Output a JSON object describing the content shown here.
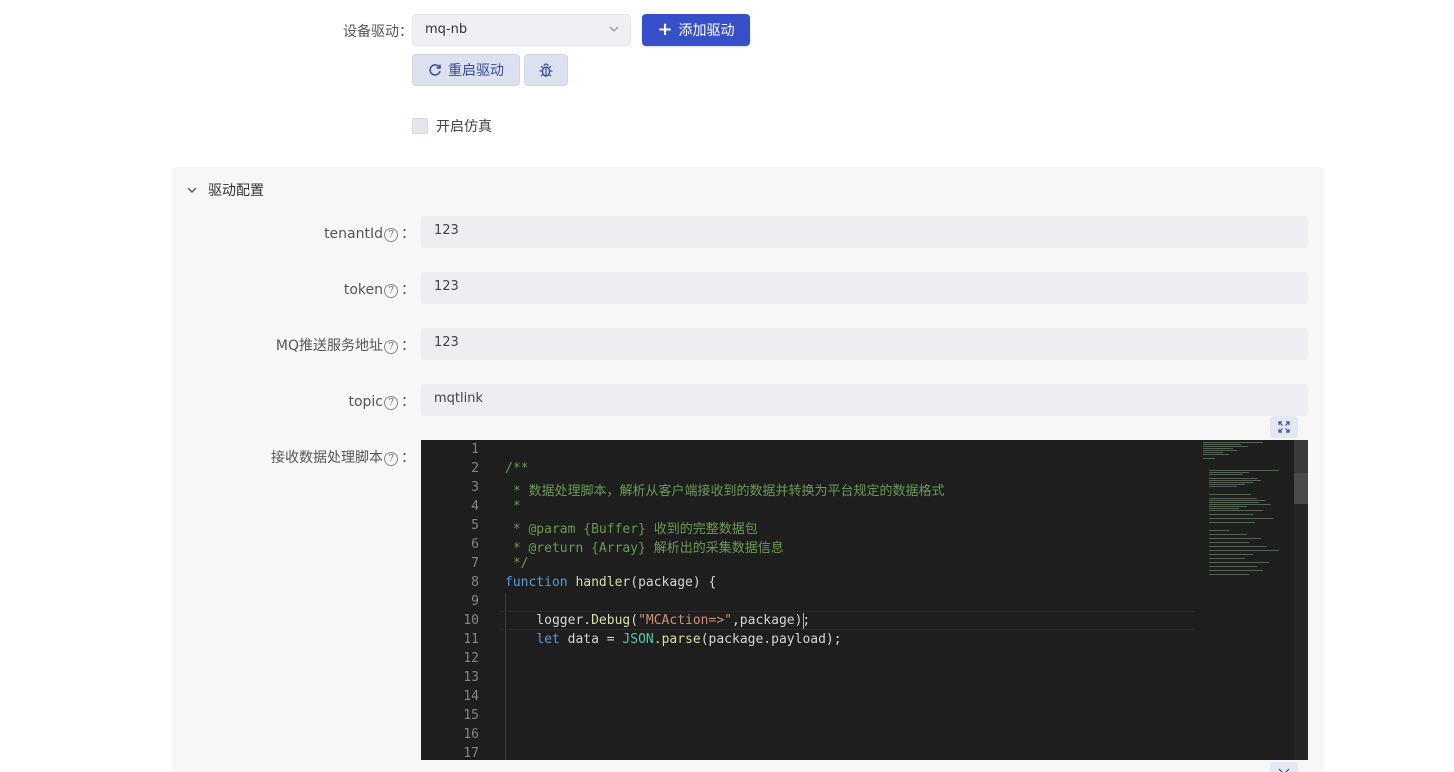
{
  "driver": {
    "label": "设备驱动",
    "selected": "mq-nb",
    "add_button": "添加驱动",
    "restart_button": "重启驱动",
    "debug_icon": "bug-icon"
  },
  "simulation": {
    "label": "开启仿真",
    "checked": false
  },
  "config": {
    "title": "驱动配置",
    "fields": [
      {
        "label": "tenantId",
        "value": "123"
      },
      {
        "label": "token",
        "value": "123"
      },
      {
        "label": "MQ推送服务地址",
        "value": "123"
      },
      {
        "label": "topic",
        "value": "mqtlink"
      }
    ],
    "script_label": "接收数据处理脚本",
    "help_glyph": "?",
    "colon": "："
  },
  "editor": {
    "line_numbers": [
      "1",
      "2",
      "3",
      "4",
      "5",
      "6",
      "7",
      "8",
      "9",
      "10",
      "11",
      "12",
      "13",
      "14",
      "15",
      "16",
      "17"
    ],
    "lines": [
      "",
      "/**",
      " * 数据处理脚本，解析从客户端接收到的数据并转换为平台规定的数据格式",
      " *",
      " * @param {Buffer} 收到的完整数据包",
      " * @return {Array} 解析出的采集数据信息",
      " */",
      "function handler(package) {",
      "",
      "    logger.Debug(\"MCAction=>\",package);",
      "    let data = JSON.parse(package.payload);",
      "",
      "",
      "",
      "",
      "",
      ""
    ]
  },
  "colors": {
    "primary": "#3750c9",
    "editor_bg": "#1e1e1e"
  }
}
